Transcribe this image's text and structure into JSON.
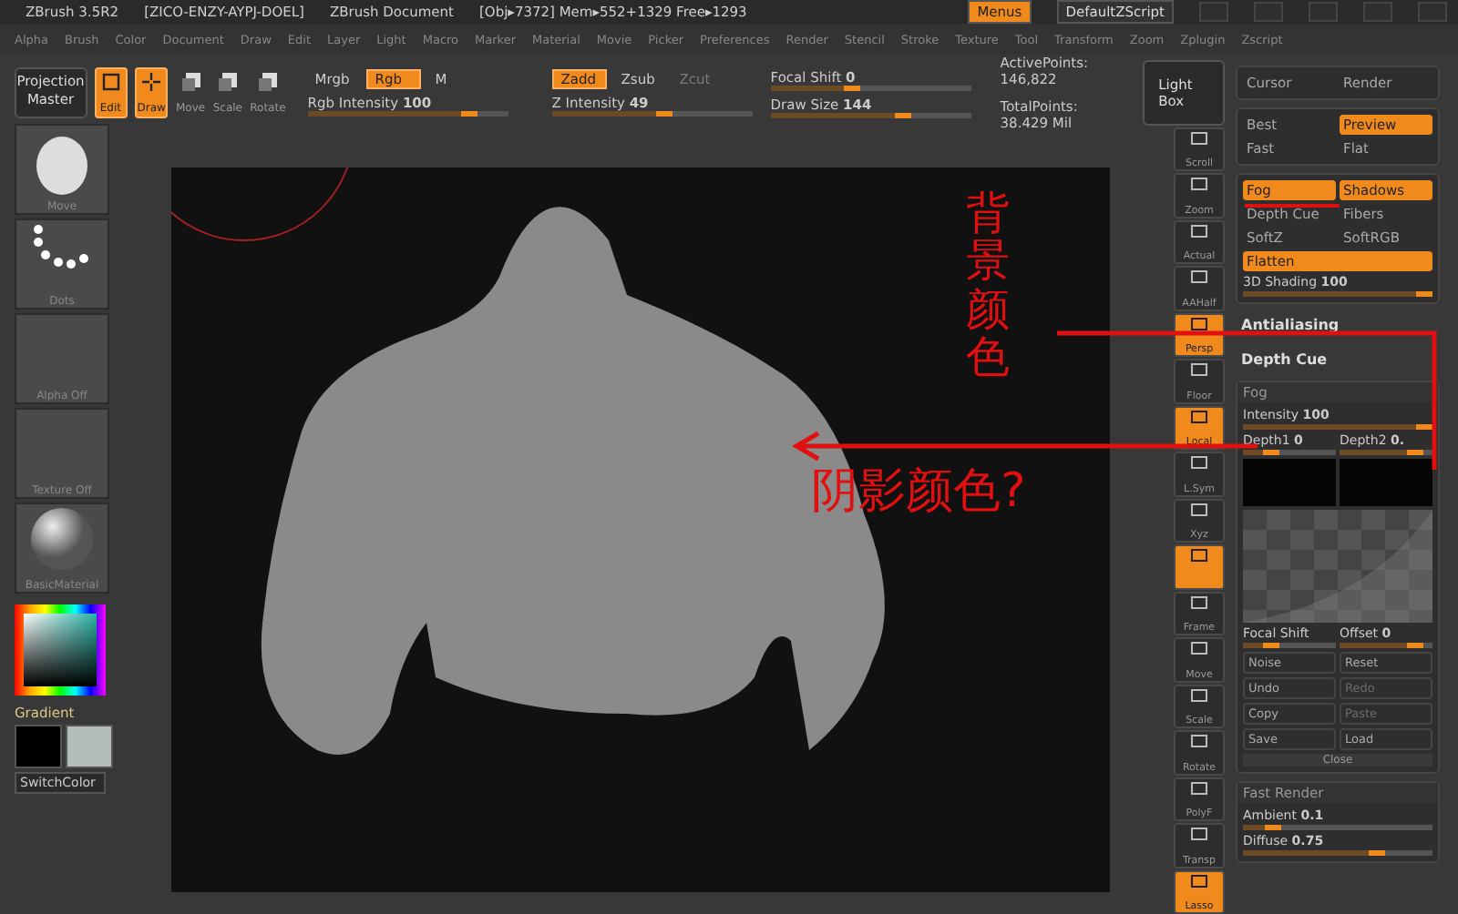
{
  "title_bar": {
    "app": "ZBrush 3.5R2",
    "serial": "[ZICO-ENZY-AYPJ-DOEL]",
    "document": "ZBrush Document",
    "memory": "[Obj▸7372] Mem▸552+1329 Free▸1293",
    "menus_button": {
      "label": "Menus",
      "on": true
    },
    "script": "DefaultZScript"
  },
  "menu_bar": [
    "Alpha",
    "Brush",
    "Color",
    "Document",
    "Draw",
    "Edit",
    "Layer",
    "Light",
    "Macro",
    "Marker",
    "Material",
    "Movie",
    "Picker",
    "Preferences",
    "Render",
    "Stencil",
    "Stroke",
    "Texture",
    "Tool",
    "Transform",
    "Zoom",
    "Zplugin",
    "Zscript"
  ],
  "toolbar": {
    "projection_master": "Projection Master",
    "tools": [
      {
        "label": "Edit",
        "on": true
      },
      {
        "label": "Draw",
        "on": true
      },
      {
        "label": "Move",
        "on": false
      },
      {
        "label": "Scale",
        "on": false
      },
      {
        "label": "Rotate",
        "on": false
      }
    ],
    "color_modes": [
      {
        "label": "Mrgb",
        "on": false,
        "disabled": false
      },
      {
        "label": "Rgb",
        "on": true,
        "disabled": false
      },
      {
        "label": "M",
        "on": false,
        "disabled": false
      }
    ],
    "rgb_intensity": {
      "label": "Rgb Intensity",
      "value": "100",
      "level": 0.85
    },
    "z_modes": [
      {
        "label": "Zadd",
        "on": true,
        "disabled": false
      },
      {
        "label": "Zsub",
        "on": false,
        "disabled": false
      },
      {
        "label": "Zcut",
        "on": false,
        "disabled": true
      }
    ],
    "z_intensity": {
      "label": "Z Intensity",
      "value": "49",
      "level": 0.6
    },
    "focal_shift": {
      "label": "Focal Shift",
      "value": "0",
      "level": 0.45
    },
    "draw_size": {
      "label": "Draw Size",
      "value": "144",
      "level": 0.7
    },
    "active_points": "ActivePoints: 146,822",
    "total_points": "TotalPoints: 38.429 Mil",
    "light_box": "Light Box"
  },
  "left_shelf": {
    "thumbnails": [
      {
        "kind": "sphere",
        "label": "Move"
      },
      {
        "kind": "dots",
        "label": "Dots"
      },
      {
        "kind": "empty",
        "label": "Alpha Off"
      },
      {
        "kind": "empty",
        "label": "Texture Off"
      },
      {
        "kind": "material",
        "label": "BasicMaterial"
      }
    ],
    "gradient": "Gradient",
    "swatches": [
      {
        "color": "#000000"
      },
      {
        "color": "#b4bcbc"
      }
    ],
    "switch_color": "SwitchColor"
  },
  "annotations": {
    "background_color": "背景颜色",
    "shadow_color": "阴影颜色?"
  },
  "right_shelf": [
    {
      "label": "Scroll",
      "on": false
    },
    {
      "label": "Zoom",
      "on": false
    },
    {
      "label": "Actual",
      "on": false
    },
    {
      "label": "AAHalf",
      "on": false
    },
    {
      "label": "Persp",
      "on": true
    },
    {
      "label": "Floor",
      "on": false
    },
    {
      "label": "Local",
      "on": true
    },
    {
      "label": "L.Sym",
      "on": false
    },
    {
      "label": "Xyz",
      "on": false
    },
    {
      "on": true
    },
    {
      "label": "Frame",
      "on": false
    },
    {
      "label": "Move",
      "on": false
    },
    {
      "label": "Scale",
      "on": false
    },
    {
      "label": "Rotate",
      "on": false
    },
    {
      "label": "PolyF",
      "on": false
    },
    {
      "label": "Transp",
      "on": false
    },
    {
      "label": "Lasso",
      "on": true
    }
  ],
  "render_panel": [
    {
      "kind": "group",
      "items": [
        {
          "kind": "button",
          "label": "Cursor",
          "on": false
        },
        {
          "kind": "button",
          "label": "Render",
          "on": false
        }
      ]
    },
    {
      "kind": "group",
      "items": [
        {
          "kind": "button",
          "label": "Best",
          "on": false
        },
        {
          "kind": "button",
          "label": "Preview",
          "on": true
        },
        {
          "kind": "button",
          "label": "Fast",
          "on": false
        },
        {
          "kind": "button",
          "label": "Flat",
          "on": false
        }
      ]
    },
    {
      "kind": "group",
      "items": [
        {
          "kind": "button",
          "label": "Fog",
          "on": true
        },
        {
          "kind": "button",
          "label": "Shadows",
          "on": true
        },
        {
          "kind": "button",
          "label": "Depth Cue",
          "on": false
        },
        {
          "kind": "button",
          "label": "Fibers",
          "on": false
        },
        {
          "kind": "button",
          "label": "SoftZ",
          "on": false
        },
        {
          "kind": "button",
          "label": "SoftRGB",
          "on": false
        },
        {
          "kind": "wide",
          "label": "Flatten",
          "on": true
        },
        {
          "kind": "slider",
          "label": "3D Shading",
          "value": "100",
          "level": 1
        }
      ]
    },
    {
      "kind": "heading",
      "label": "Antialiasing"
    },
    {
      "kind": "heading",
      "label": "Depth Cue"
    },
    {
      "kind": "group",
      "title": "Fog",
      "items": [
        {
          "kind": "slider",
          "label": "Intensity",
          "value": "100",
          "level": 1
        },
        {
          "kind": "halfslider",
          "label": "Depth1",
          "value": "0",
          "level": 0.4
        },
        {
          "kind": "halfslider",
          "label": "Depth2",
          "value": "0.",
          "level": 0.9
        },
        {
          "kind": "swatches"
        },
        {
          "kind": "curve"
        },
        {
          "kind": "halfslider",
          "label": "Focal Shift",
          "value": "",
          "level": 0.4
        },
        {
          "kind": "halfslider",
          "label": "Offset",
          "value": "0",
          "level": 0.9
        },
        {
          "kind": "small",
          "label": "Noise",
          "on": false,
          "disabled": false
        },
        {
          "kind": "small",
          "label": "Reset",
          "on": false,
          "disabled": false
        },
        {
          "kind": "small",
          "label": "Undo",
          "on": false,
          "disabled": false
        },
        {
          "kind": "small",
          "label": "Redo",
          "on": false,
          "disabled": true
        },
        {
          "kind": "small",
          "label": "Copy",
          "on": false,
          "disabled": false
        },
        {
          "kind": "small",
          "label": "Paste",
          "on": false,
          "disabled": true
        },
        {
          "kind": "small",
          "label": "Save",
          "on": false,
          "disabled": false
        },
        {
          "kind": "small",
          "label": "Load",
          "on": false,
          "disabled": false
        },
        {
          "kind": "close",
          "label": "Close"
        }
      ]
    },
    {
      "kind": "group",
      "title": "Fast Render",
      "items": [
        {
          "kind": "slider",
          "label": "Ambient",
          "value": "0.1",
          "level": 0.2
        },
        {
          "kind": "slider",
          "label": "Diffuse",
          "value": "0.75",
          "level": 0.75
        }
      ]
    }
  ]
}
